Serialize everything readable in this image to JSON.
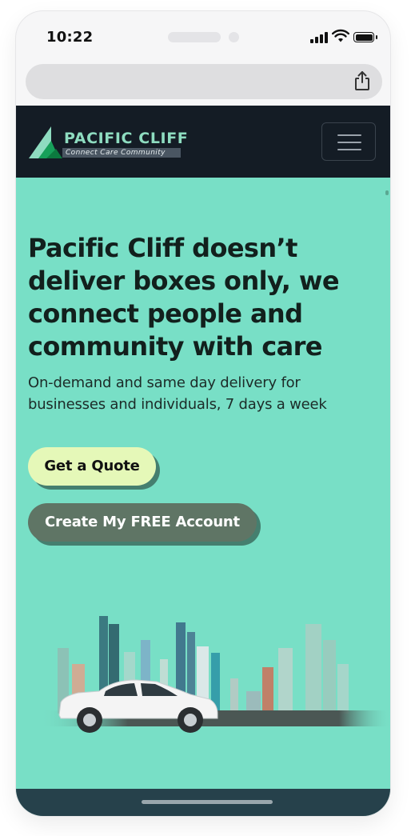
{
  "status_bar": {
    "time": "10:22"
  },
  "browser": {
    "share_icon": "share-icon"
  },
  "site": {
    "logo": {
      "title": "PACIFIC CLIFF",
      "tagline": "Connect  Care  Community"
    },
    "menu_icon": "hamburger-icon",
    "hero": {
      "headline": "Pacific Cliff doesn’t deliver boxes only, we connect people and community with care",
      "subtext": "On-demand and same day delivery for businesses and individuals, 7 days a week",
      "quote_button": "Get a Quote",
      "account_button": "Create My FREE Account"
    },
    "illustration": "city-skyline-with-white-car"
  },
  "colors": {
    "hero_background": "#78dfc6",
    "navbar_background": "#141c25",
    "quote_button": "#e5f8b8",
    "account_button": "#5f7565",
    "logo_text": "#8edcc0"
  }
}
